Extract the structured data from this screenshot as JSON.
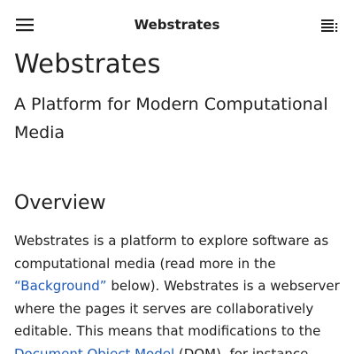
{
  "header": {
    "title": "Webstrates",
    "menu_icon": "menu-icon",
    "toc_icon": "toc-icon"
  },
  "main": {
    "title": "Webstrates",
    "subtitle": "A Platform for Modern Computational Media",
    "section_heading": "Overview",
    "paragraph": {
      "text1": "Webstrates is a platform to explore software as computational media (read more in the ",
      "link1": "“Background”",
      "text2": " below). Webstrates is a webserver where the pages it serves are collaboratively editable. This means that modifications to the ",
      "link2": "Document Object Model",
      "text3": " (DOM), for instance"
    }
  },
  "colors": {
    "text": "#212121",
    "link": "#1f5bb7",
    "background": "#ffffff"
  }
}
